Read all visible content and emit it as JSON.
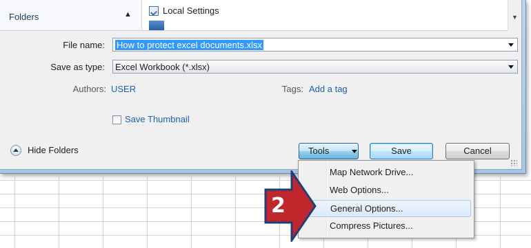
{
  "sidebar": {
    "folders_label": "Folders",
    "hide_folders_label": "Hide Folders"
  },
  "file_list": {
    "items": [
      {
        "label": "Local Settings",
        "icon": "shortcut-folder-icon"
      }
    ]
  },
  "form": {
    "file_name_label": "File name:",
    "file_name_value": "How to protect excel documents.xlsx",
    "save_as_type_label": "Save as type:",
    "save_as_type_value": "Excel Workbook (*.xlsx)",
    "authors_label": "Authors:",
    "authors_value": "USER",
    "tags_label": "Tags:",
    "tags_value": "Add a tag",
    "thumbnail_label": "Save Thumbnail",
    "thumbnail_checked": false
  },
  "buttons": {
    "tools": "Tools",
    "save": "Save",
    "cancel": "Cancel"
  },
  "tools_menu": {
    "items": [
      "Map Network Drive...",
      "Web Options...",
      "General Options...",
      "Compress Pictures..."
    ],
    "highlighted_index": 2
  },
  "callout": {
    "step": "2",
    "color": "#c0272d",
    "border_color": "#1f3f7a"
  }
}
